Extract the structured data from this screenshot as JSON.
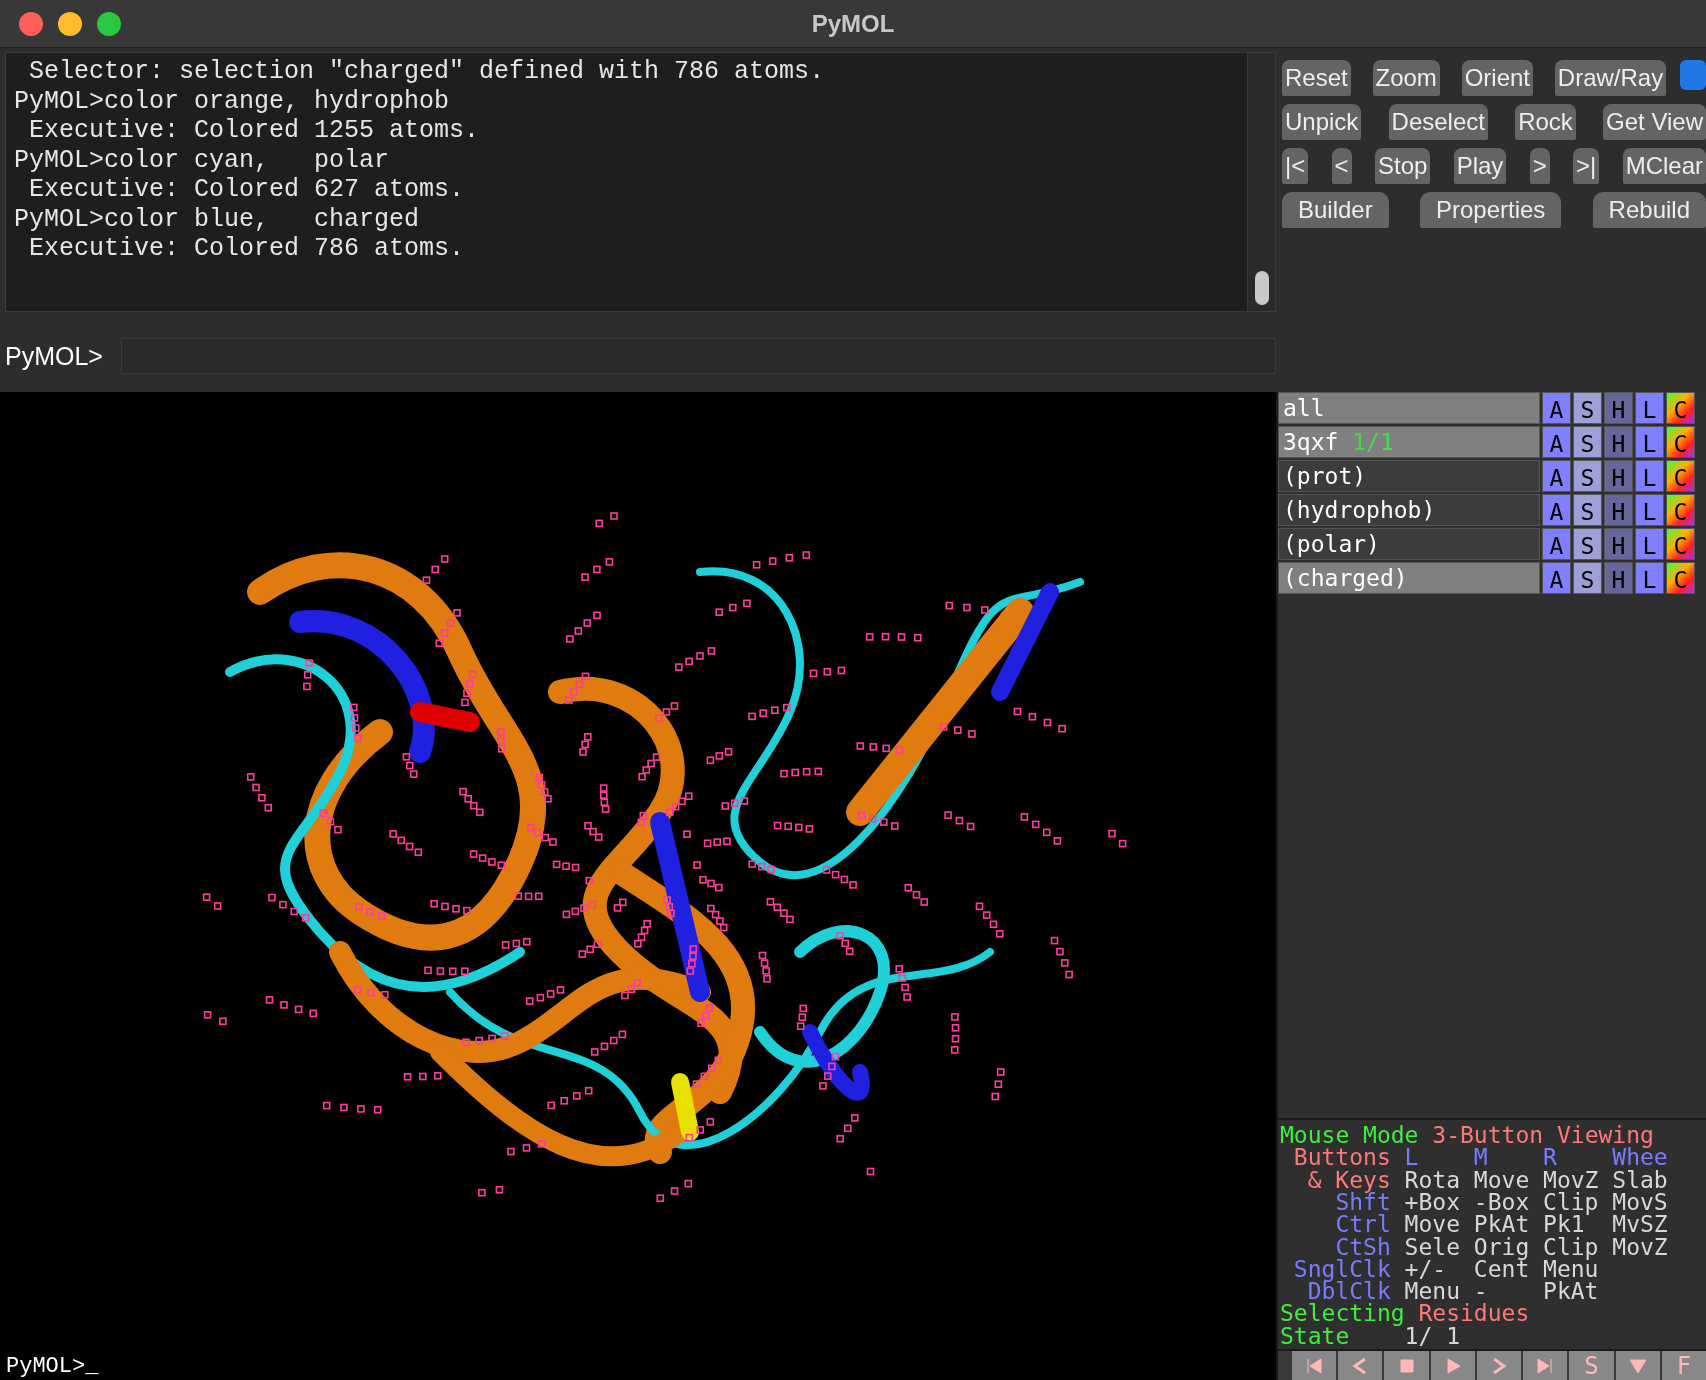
{
  "window": {
    "title": "PyMOL"
  },
  "log": {
    "lines": [
      {
        "kind": "output",
        "text": "Selector: selection \"charged\" defined with 786 atoms."
      },
      {
        "kind": "command",
        "text": "PyMOL>color orange, hydrophob"
      },
      {
        "kind": "output",
        "text": "Executive: Colored 1255 atoms."
      },
      {
        "kind": "command",
        "text": "PyMOL>color cyan,   polar"
      },
      {
        "kind": "output",
        "text": "Executive: Colored 627 atoms."
      },
      {
        "kind": "command",
        "text": "PyMOL>color blue,   charged"
      },
      {
        "kind": "output",
        "text": "Executive: Colored 786 atoms."
      }
    ]
  },
  "command": {
    "prompt": "PyMOL>"
  },
  "buttons": [
    [
      "Reset",
      "Zoom",
      "Orient",
      "Draw/Ray"
    ],
    [
      "Unpick",
      "Deselect",
      "Rock",
      "Get View"
    ],
    [
      "|<",
      "<",
      "Stop",
      "Play",
      ">",
      ">|",
      "MClear"
    ],
    [
      "Builder",
      "Properties",
      "Rebuild"
    ]
  ],
  "objects": [
    {
      "name": "all",
      "enabled": true,
      "actions": [
        "A",
        "S",
        "H",
        "L",
        "C"
      ]
    },
    {
      "name": "3qxf",
      "states": "1/1",
      "enabled": true,
      "actions": [
        "A",
        "S",
        "H",
        "L",
        "C"
      ]
    },
    {
      "name": "(prot)",
      "enabled": false,
      "actions": [
        "A",
        "S",
        "H",
        "L",
        "C"
      ]
    },
    {
      "name": "(hydrophob)",
      "enabled": false,
      "actions": [
        "A",
        "S",
        "H",
        "L",
        "C"
      ]
    },
    {
      "name": "(polar)",
      "enabled": false,
      "actions": [
        "A",
        "S",
        "H",
        "L",
        "C"
      ]
    },
    {
      "name": "(charged)",
      "enabled": true,
      "actions": [
        "A",
        "S",
        "H",
        "L",
        "C"
      ]
    }
  ],
  "mouse": {
    "lines": [
      [
        {
          "kind": "title",
          "text": "Mouse Mode"
        },
        {
          "kind": "value",
          "text": "3-Button Viewing"
        }
      ],
      [
        {
          "kind": "value",
          "text": "Buttons"
        },
        {
          "kind": "key",
          "text": "L"
        },
        {
          "kind": "key",
          "text": "M"
        },
        {
          "kind": "key",
          "text": "R"
        },
        {
          "kind": "key",
          "text": "Whee"
        }
      ],
      [
        {
          "kind": "value",
          "text": "& Keys"
        },
        {
          "kind": "action",
          "text": "Rota"
        },
        {
          "kind": "action",
          "text": "Move"
        },
        {
          "kind": "action",
          "text": "MovZ"
        },
        {
          "kind": "action",
          "text": "Slab"
        }
      ],
      [
        {
          "kind": "key",
          "text": "Shft"
        },
        {
          "kind": "action",
          "text": "+Box"
        },
        {
          "kind": "action",
          "text": "-Box"
        },
        {
          "kind": "action",
          "text": "Clip"
        },
        {
          "kind": "action",
          "text": "MovS"
        }
      ],
      [
        {
          "kind": "key",
          "text": "Ctrl"
        },
        {
          "kind": "action",
          "text": "Move"
        },
        {
          "kind": "action",
          "text": "PkAt"
        },
        {
          "kind": "action",
          "text": "Pk1"
        },
        {
          "kind": "action",
          "text": "MvSZ"
        }
      ],
      [
        {
          "kind": "key",
          "text": "CtSh"
        },
        {
          "kind": "action",
          "text": "Sele"
        },
        {
          "kind": "action",
          "text": "Orig"
        },
        {
          "kind": "action",
          "text": "Clip"
        },
        {
          "kind": "action",
          "text": "MovZ"
        }
      ],
      [
        {
          "kind": "key",
          "text": "SnglClk"
        },
        {
          "kind": "action",
          "text": "+/-"
        },
        {
          "kind": "action",
          "text": "Cent"
        },
        {
          "kind": "action",
          "text": "Menu"
        }
      ],
      [
        {
          "kind": "key",
          "text": "DblClk"
        },
        {
          "kind": "action",
          "text": "Menu"
        },
        {
          "kind": "action",
          "text": "-"
        },
        {
          "kind": "action",
          "text": "PkAt"
        }
      ],
      [
        {
          "kind": "title",
          "text": "Selecting"
        },
        {
          "kind": "value",
          "text": "Residues"
        }
      ],
      [
        {
          "kind": "title",
          "text": "State"
        },
        {
          "kind": "action",
          "text": "1/"
        },
        {
          "kind": "action",
          "text": "1"
        }
      ]
    ]
  },
  "viewport": {
    "prompt": "PyMOL>_"
  },
  "transport": [
    {
      "kind": "first"
    },
    {
      "kind": "prev"
    },
    {
      "kind": "stop"
    },
    {
      "kind": "play"
    },
    {
      "kind": "next"
    },
    {
      "kind": "last"
    },
    {
      "kind": "text",
      "label": "S"
    },
    {
      "kind": "down"
    },
    {
      "kind": "text",
      "label": "F"
    }
  ]
}
